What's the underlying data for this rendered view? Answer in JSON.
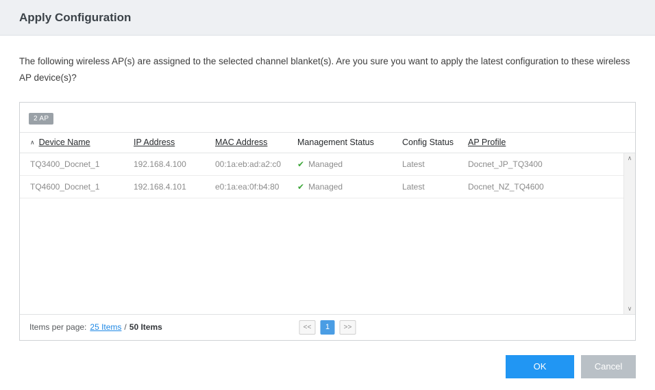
{
  "dialog": {
    "title": "Apply Configuration",
    "message": "The following wireless AP(s) are assigned to the selected channel blanket(s). Are you sure you want to apply the latest configuration to these wireless AP device(s)?"
  },
  "table": {
    "badge": "2 AP",
    "columns": [
      "Device Name",
      "IP Address",
      "MAC Address",
      "Management Status",
      "Config Status",
      "AP Profile"
    ],
    "rows": [
      {
        "device_name": "TQ3400_Docnet_1",
        "ip_address": "192.168.4.100",
        "mac_address": "00:1a:eb:ad:a2:c0",
        "management_status": "Managed",
        "config_status": "Latest",
        "ap_profile": "Docnet_JP_TQ3400"
      },
      {
        "device_name": "TQ4600_Docnet_1",
        "ip_address": "192.168.4.101",
        "mac_address": "e0:1a:ea:0f:b4:80",
        "management_status": "Managed",
        "config_status": "Latest",
        "ap_profile": "Docnet_NZ_TQ4600"
      }
    ]
  },
  "pagination": {
    "items_per_page_label": "Items per page:",
    "items_per_page_link": "25 Items",
    "separator": "/",
    "total_items": "50 Items",
    "prev": "<<",
    "page": "1",
    "next": ">>"
  },
  "buttons": {
    "ok": "OK",
    "cancel": "Cancel"
  },
  "icons": {
    "sort_asc": "∧",
    "check": "✔",
    "scroll_up": "∧",
    "scroll_down": "∨"
  },
  "colors": {
    "accent": "#2196f3",
    "success": "#3da639",
    "header_bg": "#eef0f3"
  }
}
